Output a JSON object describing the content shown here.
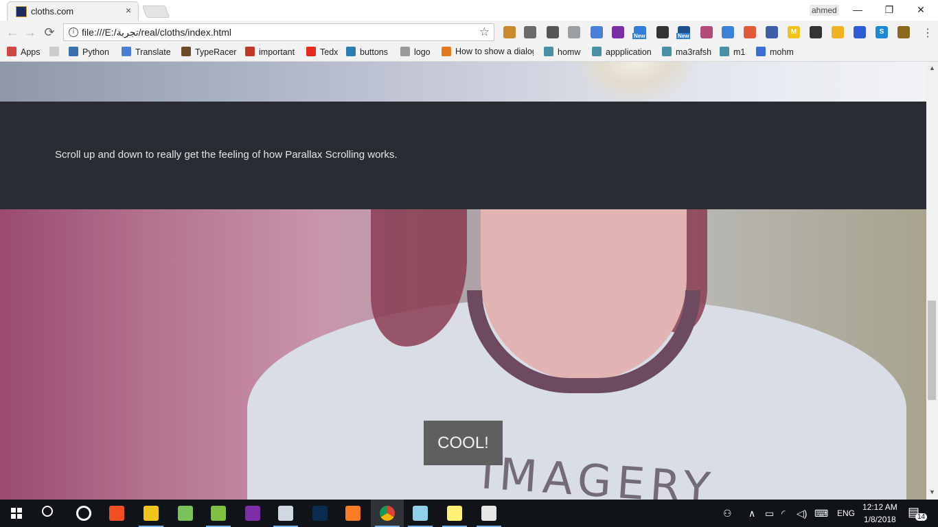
{
  "browser": {
    "tab_title": "cloths.com",
    "tab_close": "×",
    "user": "ahmed",
    "window_controls": {
      "minimize": "—",
      "maximize": "❐",
      "close": "✕"
    },
    "url": "file:///E:/تجربة/real/cloths/index.html",
    "nav": {
      "back": "←",
      "forward": "→",
      "reload": "⟳"
    },
    "extensions": [
      {
        "name": "wrench-icon",
        "color": "#c98a2e"
      },
      {
        "name": "camera-icon",
        "color": "#6b6b6b"
      },
      {
        "name": "bulb-icon",
        "color": "#555555"
      },
      {
        "name": "dropbox-icon",
        "color": "#9aa0a6"
      },
      {
        "name": "translate-icon",
        "color": "#4a7fd8"
      },
      {
        "name": "onenote-icon",
        "color": "#7b2fa6"
      },
      {
        "name": "new-badge-icon",
        "color": "#2f7fd8",
        "badge": "New"
      },
      {
        "name": "film-icon",
        "color": "#333333"
      },
      {
        "name": "speed-icon",
        "color": "#1f4f8a",
        "badge": "New"
      },
      {
        "name": "image-icon",
        "color": "#b24b7a"
      },
      {
        "name": "download-icon",
        "color": "#3b82d6"
      },
      {
        "name": "color-wheel-icon",
        "color": "#e05a3a"
      },
      {
        "name": "eyedropper-icon",
        "color": "#3d5da8"
      },
      {
        "name": "m-icon",
        "color": "#f0c419",
        "label": "M"
      },
      {
        "name": "evernote-icon",
        "color": "#333333"
      },
      {
        "name": "drive-icon",
        "color": "#f2b322"
      },
      {
        "name": "calendar-icon",
        "color": "#2e5bd6"
      },
      {
        "name": "s-icon",
        "color": "#1a8ad6",
        "label": "S"
      },
      {
        "name": "shield-icon",
        "color": "#8a6a1a"
      }
    ],
    "menu": "⋮"
  },
  "bookmarks": [
    {
      "label": "Apps",
      "color": "#d64545"
    },
    {
      "label": "",
      "color": "#cccccc"
    },
    {
      "label": "Python",
      "color": "#3a6fb0"
    },
    {
      "label": "Translate",
      "color": "#4a7fd8"
    },
    {
      "label": "TypeRacer",
      "color": "#6b4b2a"
    },
    {
      "label": "important",
      "color": "#c0392b"
    },
    {
      "label": "Tedx",
      "color": "#e62b1e"
    },
    {
      "label": "buttons",
      "color": "#2a7fb0"
    },
    {
      "label": "logo",
      "color": "#999999"
    },
    {
      "label": "How to show a dialog",
      "color": "#e37a1f"
    },
    {
      "label": "homw",
      "color": "#4a90a4"
    },
    {
      "label": "appplication",
      "color": "#4a90a4"
    },
    {
      "label": "ma3rafsh",
      "color": "#4a90a4"
    },
    {
      "label": "m1",
      "color": "#4a90a4"
    },
    {
      "label": "mohm",
      "color": "#3b6fd6"
    }
  ],
  "page": {
    "band_text": "Scroll up and down to really get the feeling of how Parallax Scrolling works.",
    "print_text": "IMAGERY",
    "cool_button": "COOL!"
  },
  "scrollbar": {
    "up": "▲",
    "down": "▼",
    "position_fraction": 0.72
  },
  "taskbar": {
    "apps": [
      {
        "name": "start-icon",
        "color": "#ffffff"
      },
      {
        "name": "search-icon",
        "color": "#ffffff"
      },
      {
        "name": "cortana-icon",
        "color": "#ffffff"
      },
      {
        "name": "store-icon",
        "color": "#f25022"
      },
      {
        "name": "explorer-icon",
        "color": "#f0c419"
      },
      {
        "name": "android-studio-icon",
        "color": "#78c257"
      },
      {
        "name": "notepadpp-icon",
        "color": "#80c040"
      },
      {
        "name": "onenote-taskbar-icon",
        "color": "#7b2fa6"
      },
      {
        "name": "photos-icon",
        "color": "#cfd8e3"
      },
      {
        "name": "photoshop-icon",
        "color": "#0a2a50"
      },
      {
        "name": "xampp-icon",
        "color": "#fb7a24"
      },
      {
        "name": "chrome-icon",
        "color": "#db4437"
      },
      {
        "name": "3d-icon",
        "color": "#8fd0e8"
      },
      {
        "name": "sticky-notes-icon",
        "color": "#fff176"
      },
      {
        "name": "paint-icon",
        "color": "#e6e6e6"
      }
    ],
    "language": "ENG",
    "time": "12:12 AM",
    "date": "1/8/2018",
    "notification_count": "14"
  }
}
